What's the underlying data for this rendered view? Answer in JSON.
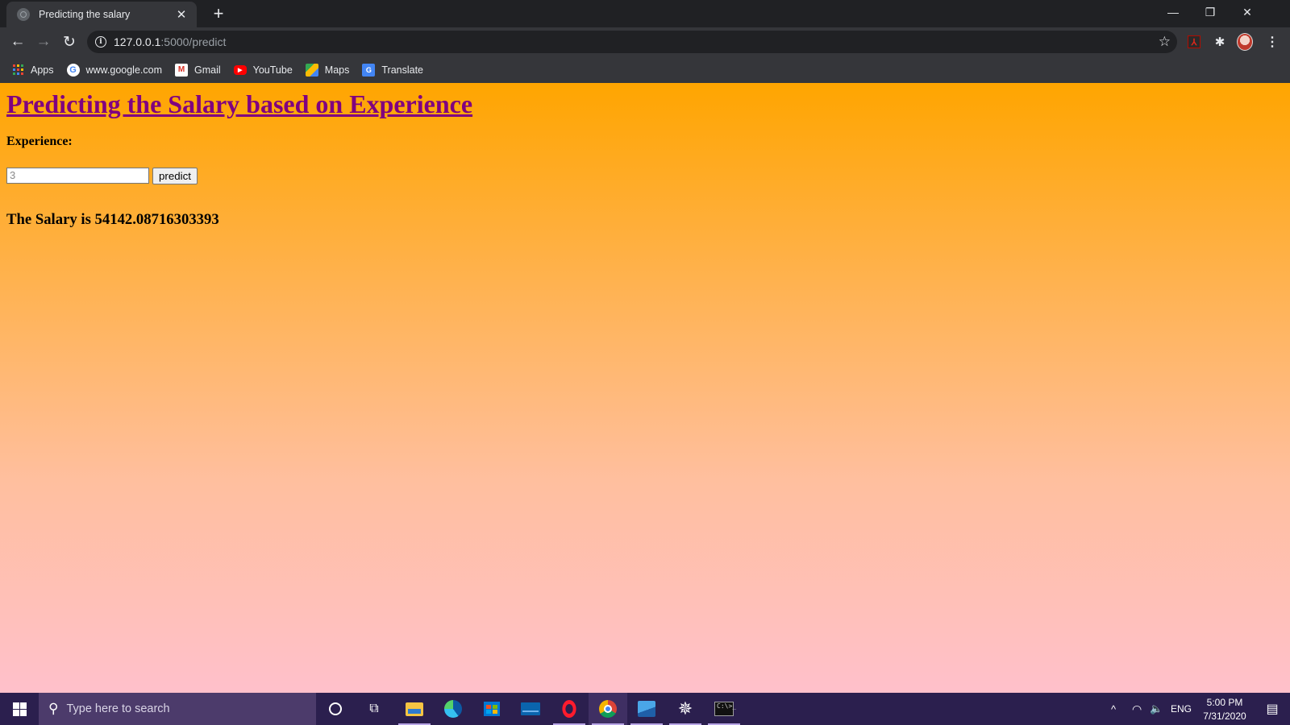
{
  "browser": {
    "tab": {
      "title": "Predicting the salary",
      "close_glyph": "✕"
    },
    "new_tab_glyph": "+",
    "window_controls": {
      "minimize": "—",
      "restore": "❐",
      "close": "✕"
    },
    "nav": {
      "back_glyph": "←",
      "forward_glyph": "→",
      "reload_glyph": "↻"
    },
    "address": {
      "host": "127.0.0.1",
      "path": ":5000/predict",
      "info_glyph": "i",
      "star_glyph": "☆"
    },
    "extensions": {
      "acrobat_glyph": "⅄",
      "puzzle_glyph": "✱",
      "menu_glyph": "⋮"
    },
    "bookmarks": [
      {
        "label": "Apps",
        "icon": "apps-grid-icon"
      },
      {
        "label": "www.google.com",
        "icon": "google-icon",
        "glyph": "G"
      },
      {
        "label": "Gmail",
        "icon": "gmail-icon",
        "glyph": "M"
      },
      {
        "label": "YouTube",
        "icon": "youtube-icon",
        "glyph": "▶"
      },
      {
        "label": "Maps",
        "icon": "maps-icon",
        "glyph": ""
      },
      {
        "label": "Translate",
        "icon": "translate-icon",
        "glyph": "G"
      }
    ]
  },
  "page": {
    "title": "Predicting the Salary based on Experience",
    "experience_label": "Experience:",
    "input_value": "3",
    "predict_button": "predict",
    "result": "The Salary is 54142.08716303393",
    "colors": {
      "gradient_top": "#ffa500",
      "gradient_bottom": "#ffc0cb",
      "title": "#800080"
    }
  },
  "taskbar": {
    "search_placeholder": "Type here to search",
    "search_glyph": "⚲",
    "taskview_glyph": "⧉",
    "spider_glyph": "✵",
    "cmd_text": "C:\\>_",
    "tray": {
      "chevron_glyph": "^",
      "wifi_glyph": "◠",
      "volume_glyph": "🔈",
      "language": "ENG"
    },
    "clock": {
      "time": "5:00 PM",
      "date": "7/31/2020"
    },
    "notification_glyph": "▤"
  }
}
